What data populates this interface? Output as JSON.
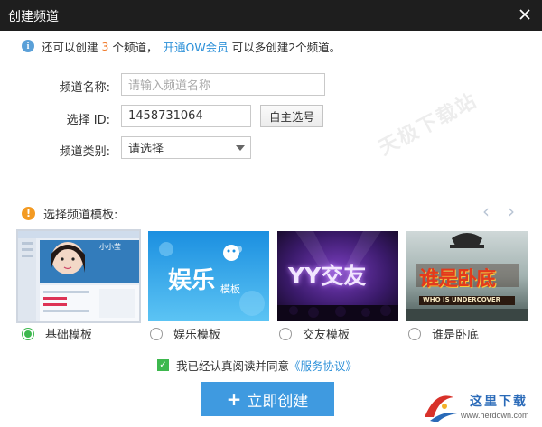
{
  "window": {
    "title": "创建频道"
  },
  "info": {
    "prefix": "还可以创建",
    "count": "3",
    "mid": "个频道，",
    "link": "开通OW会员",
    "suffix": "可以多创建2个频道。"
  },
  "form": {
    "name_label": "频道名称:",
    "name_placeholder": "请输入频道名称",
    "id_label": "选择 ID:",
    "id_value": "1458731064",
    "id_button": "自主选号",
    "type_label": "频道类别:",
    "type_value": "请选择"
  },
  "watermark": "天极下载站",
  "templates": {
    "heading": "选择频道模板:",
    "items": [
      {
        "label": "基础模板",
        "selected": true,
        "thumb_text": "小小莹"
      },
      {
        "label": "娱乐模板",
        "selected": false,
        "thumb_text": "娱乐",
        "thumb_sub": "模板"
      },
      {
        "label": "交友模板",
        "selected": false,
        "thumb_text": "YY交友"
      },
      {
        "label": "谁是卧底",
        "selected": false,
        "thumb_text": "谁是卧底",
        "thumb_sub": "WHO IS UNDERCOVER"
      }
    ]
  },
  "agreement": {
    "text": "我已经认真阅读并同意",
    "link": "《服务协议》",
    "checked": true
  },
  "create_button": "立即创建",
  "corner_logo": {
    "brand": "这里下载",
    "url": "www.herdown.com"
  },
  "colors": {
    "accent": "#3f9ae0",
    "link": "#2a8fd8",
    "count": "#f07a2a",
    "check": "#3db84e",
    "titlebar": "#1e1e1e"
  }
}
